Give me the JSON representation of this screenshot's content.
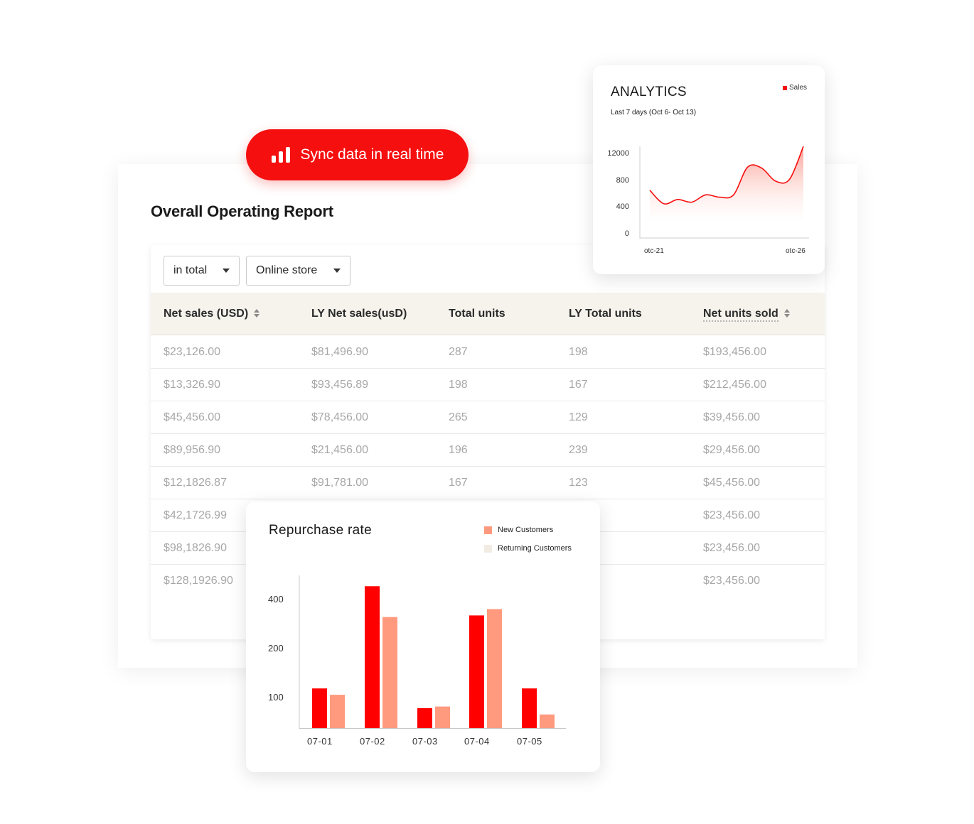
{
  "report": {
    "title": "Overall Operating Report",
    "filters": [
      {
        "value": "in total"
      },
      {
        "value": "Online store"
      }
    ],
    "columns": [
      "Net sales (USD)",
      "LY Net sales(usD)",
      "Total units",
      "LY Total units",
      "Net units sold"
    ],
    "rows": [
      [
        "$23,126.00",
        "$81,496.90",
        "287",
        "198",
        "$193,456.00"
      ],
      [
        "$13,326.90",
        "$93,456.89",
        "198",
        "167",
        "$212,456.00"
      ],
      [
        "$45,456.00",
        "$78,456.00",
        "265",
        "129",
        "$39,456.00"
      ],
      [
        "$89,956.90",
        "$21,456.00",
        "196",
        "239",
        "$29,456.00"
      ],
      [
        "$12,1826.87",
        "$91,781.00",
        "167",
        "123",
        "$45,456.00"
      ],
      [
        "$42,1726.99",
        "",
        "",
        "",
        "$23,456.00"
      ],
      [
        "$98,1826.90",
        "",
        "",
        "",
        "$23,456.00"
      ],
      [
        "$128,1926.90",
        "",
        "",
        "",
        "$23,456.00"
      ]
    ]
  },
  "sync": {
    "label": "Sync data in real time",
    "icon": "bar-chart-icon",
    "color": "#f50f0f"
  },
  "analytics": {
    "title": "ANALYTICS",
    "subtitle": "Last 7 days (Oct 6- Oct 13)",
    "legend": "Sales",
    "color": "#f50f0f"
  },
  "repurchase": {
    "title": "Repurchase rate",
    "legend": [
      {
        "name": "New Customers",
        "color": "#ff9a7e"
      },
      {
        "name": "Returning Customers",
        "color": "#f1ebe4"
      }
    ]
  },
  "chart_data": [
    {
      "type": "area",
      "title": "ANALYTICS",
      "subtitle": "Last 7 days (Oct 6- Oct 13)",
      "y_ticks": [
        "12000",
        "800",
        "400",
        "0"
      ],
      "x_ticks": [
        "otc-21",
        "otc-26"
      ],
      "series": [
        {
          "name": "Sales",
          "values": [
            620,
            445,
            500,
            465,
            560,
            530,
            560,
            920,
            910,
            740,
            760,
            1190
          ]
        }
      ],
      "ylim": [
        0,
        1200
      ],
      "grid": false,
      "legend_position": "top-right"
    },
    {
      "type": "bar",
      "title": "Repurchase rate",
      "categories": [
        "07-01",
        "07-02",
        "07-03",
        "07-04",
        "07-05"
      ],
      "y_ticks": [
        "400",
        "200",
        "100"
      ],
      "series": [
        {
          "values": [
            125,
            447,
            63,
            355,
            125
          ],
          "color": "#ff0000"
        },
        {
          "values": [
            105,
            350,
            68,
            375,
            43
          ],
          "color": "#ff9a7e"
        }
      ],
      "ylim": [
        0,
        600
      ],
      "grid": false,
      "legend_position": "top-right"
    }
  ]
}
